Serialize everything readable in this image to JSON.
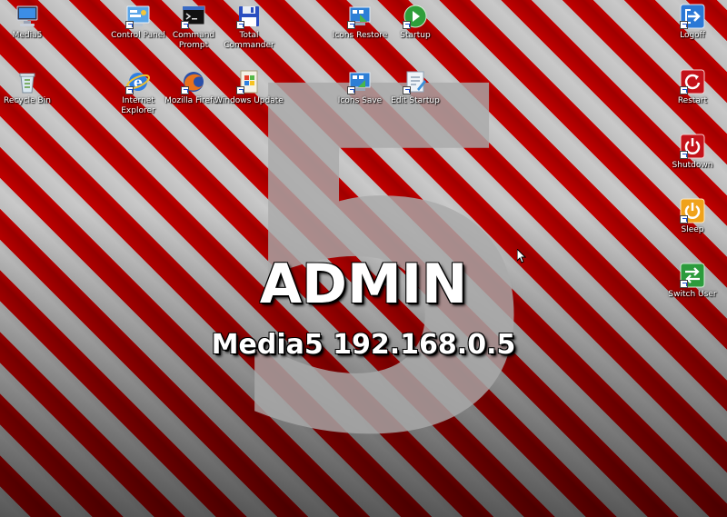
{
  "desktop": {
    "wallpaper_number": "5",
    "title": "ADMIN",
    "subtitle": "Media5 192.168.0.5",
    "colors": {
      "stripe_red": "#c40000",
      "stripe_gray": "#c0c0c0",
      "text": "#ffffff"
    }
  },
  "icons": {
    "media5": {
      "label": "Media5",
      "icon": "computer-icon"
    },
    "recycle_bin": {
      "label": "Recycle Bin",
      "icon": "recycle-bin-icon"
    },
    "control_panel": {
      "label": "Control Panel",
      "icon": "control-panel-icon"
    },
    "internet_explorer": {
      "label": "Internet Explorer",
      "icon": "internet-explorer-icon"
    },
    "command_prompt": {
      "label": "Command Prompt",
      "icon": "command-prompt-icon"
    },
    "mozilla_firefox": {
      "label": "Mozilla Firefox",
      "icon": "firefox-icon"
    },
    "total_commander": {
      "label": "Total Commander",
      "icon": "floppy-disk-icon"
    },
    "windows_update": {
      "label": "Windows Update",
      "icon": "windows-update-icon"
    },
    "icons_restore": {
      "label": "Icons Restore",
      "icon": "icons-restore-icon"
    },
    "icons_save": {
      "label": "Icons Save",
      "icon": "icons-save-icon"
    },
    "startup": {
      "label": "Startup",
      "icon": "green-arrow-icon"
    },
    "edit_startup": {
      "label": "Edit Startup",
      "icon": "edit-icon"
    },
    "logoff": {
      "label": "Logoff",
      "icon": "logoff-icon"
    },
    "restart": {
      "label": "Restart",
      "icon": "restart-icon"
    },
    "shutdown": {
      "label": "Shutdown",
      "icon": "shutdown-icon"
    },
    "sleep": {
      "label": "Sleep",
      "icon": "sleep-icon"
    },
    "switch_user": {
      "label": "Switch User",
      "icon": "switch-user-icon"
    }
  }
}
